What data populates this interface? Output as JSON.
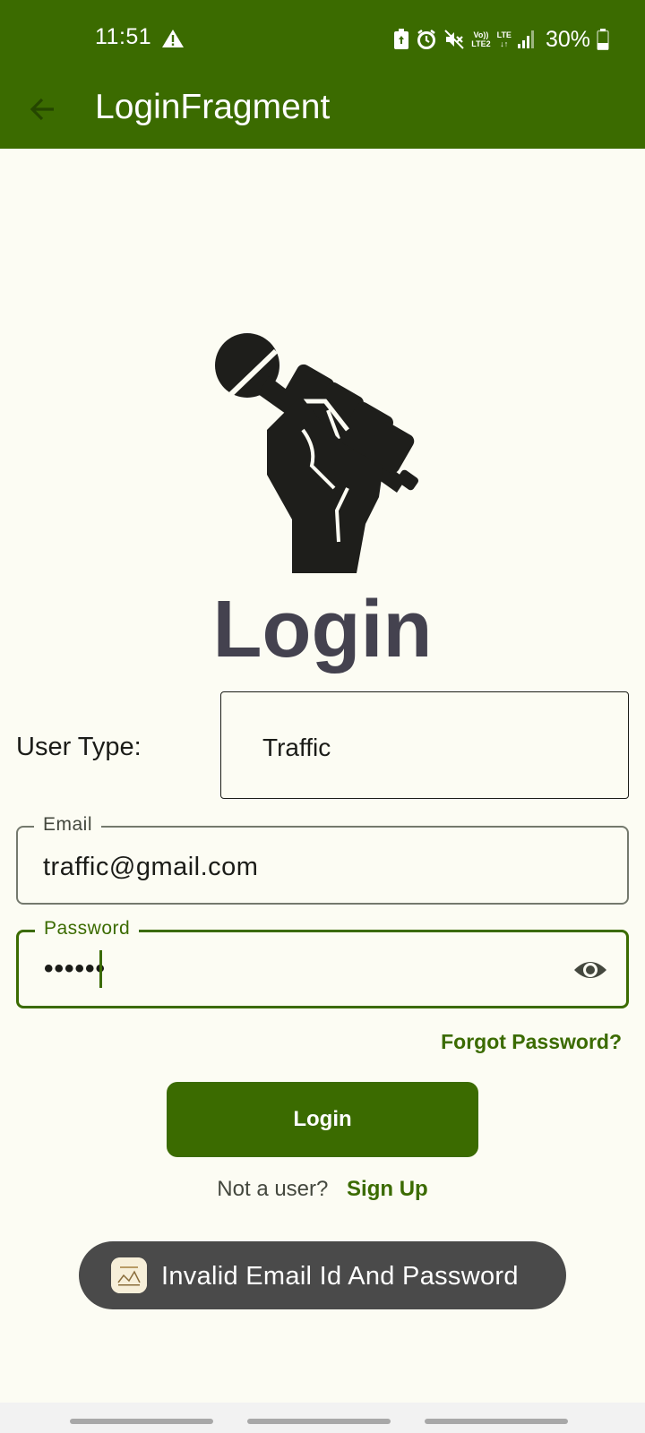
{
  "status_bar": {
    "time": "11:51",
    "network_top": "Vo))",
    "network_bottom": "LTE2",
    "lte_top": "LTE",
    "lte_bottom": "↓↑",
    "battery": "30%"
  },
  "app_bar": {
    "title": "LoginFragment",
    "back_icon": "arrow-left-icon"
  },
  "logo": {
    "icon": "fist-microphone-icon"
  },
  "heading": "Login",
  "user_type": {
    "label": "User Type:",
    "value": "Traffic"
  },
  "email": {
    "label": "Email",
    "value": "traffic@gmail.com"
  },
  "password": {
    "label": "Password",
    "masked_value": "••••••",
    "toggle_icon": "eye-icon"
  },
  "forgot_password": "Forgot Password?",
  "login_button": "Login",
  "signup": {
    "prompt": "Not a user?",
    "link": "Sign Up"
  },
  "toast": {
    "message": "Invalid Email Id And Password"
  },
  "colors": {
    "primary": "#3b6b00",
    "background": "#fcfcf3",
    "heading": "#44424f",
    "toast": "#4a4a4a"
  }
}
